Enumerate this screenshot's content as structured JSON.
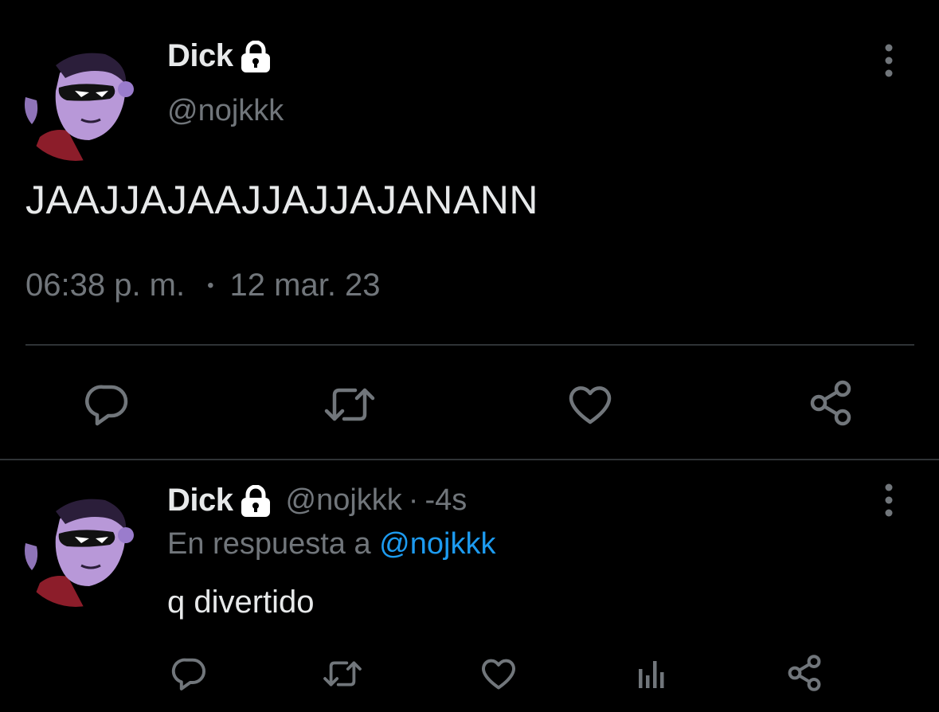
{
  "main_tweet": {
    "display_name": "Dick",
    "handle": "@nojkkk",
    "text": "JAAJJAJAAJJAJJAJANANN",
    "time": "06:38 p. m.",
    "separator": "•",
    "date": "12 mar. 23",
    "icons": {
      "protected": "lock-icon",
      "more": "more-vertical-icon",
      "actions": [
        "reply-icon",
        "retweet-icon",
        "like-icon",
        "share-icon"
      ]
    }
  },
  "reply_tweet": {
    "display_name": "Dick",
    "handle": "@nojkkk",
    "dot": "·",
    "time_ago": "-4s",
    "reply_prefix": "En respuesta a",
    "reply_mention": "@nojkkk",
    "text": "q divertido",
    "icons": {
      "protected": "lock-icon",
      "more": "more-vertical-icon",
      "actions": [
        "reply-icon",
        "retweet-icon",
        "like-icon",
        "analytics-icon",
        "share-icon"
      ]
    }
  },
  "colors": {
    "background": "#000000",
    "primary_text": "#e7e9ea",
    "secondary_text": "#71767b",
    "link": "#1d9bf0",
    "divider": "#2f3336"
  }
}
